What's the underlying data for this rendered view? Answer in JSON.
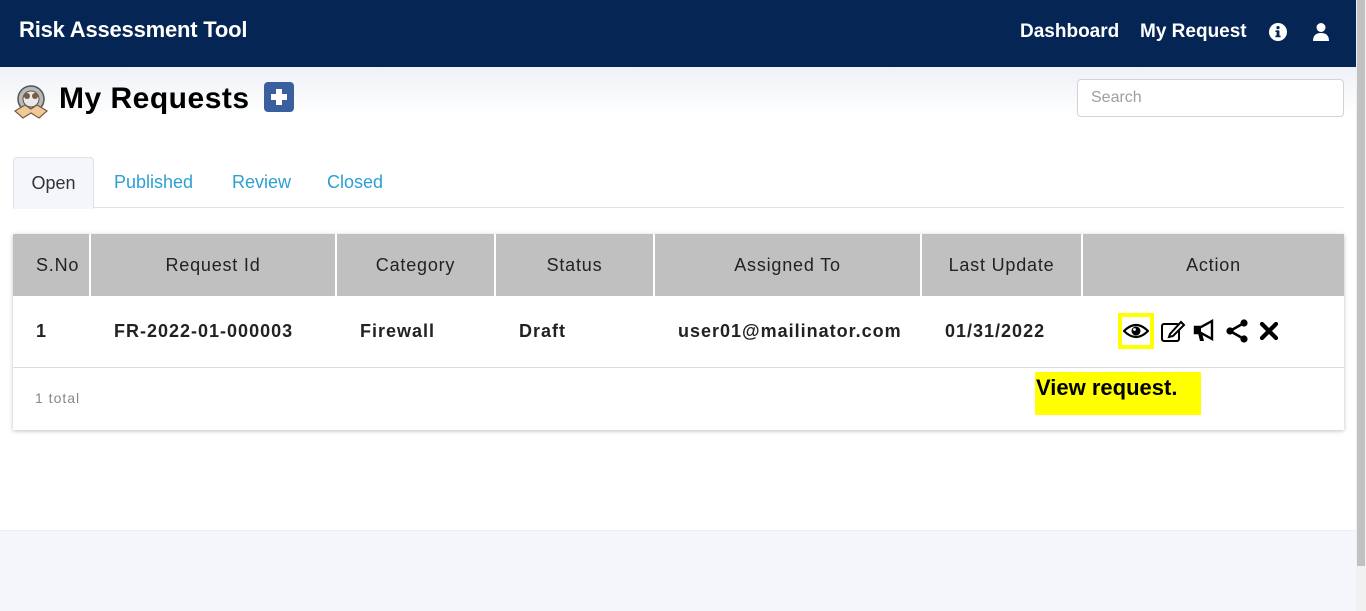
{
  "navbar": {
    "brand": "Risk Assessment Tool",
    "links": [
      "Dashboard",
      "My Request"
    ],
    "icons": [
      "info-circle-icon",
      "user-icon"
    ],
    "background": "#052554"
  },
  "header": {
    "title": "My Requests",
    "search_placeholder": "Search"
  },
  "tabs": [
    {
      "label": "Open",
      "active": true
    },
    {
      "label": "Published",
      "active": false
    },
    {
      "label": "Review",
      "active": false
    },
    {
      "label": "Closed",
      "active": false
    }
  ],
  "table": {
    "columns": [
      "S.No",
      "Request Id",
      "Category",
      "Status",
      "Assigned To",
      "Last Update",
      "Action"
    ],
    "rows": [
      {
        "sno": "1",
        "request_id": "FR-2022-01-000003",
        "category": "Firewall",
        "status": "Draft",
        "assigned_to": "user01@mailinator.com",
        "last_update": "01/31/2022",
        "actions": [
          "eye-icon",
          "edit-icon",
          "megaphone-icon",
          "share-icon",
          "close-icon"
        ]
      }
    ],
    "total_label": "1 total"
  },
  "tooltip": {
    "text": "View request.",
    "color": "#ffff00"
  }
}
